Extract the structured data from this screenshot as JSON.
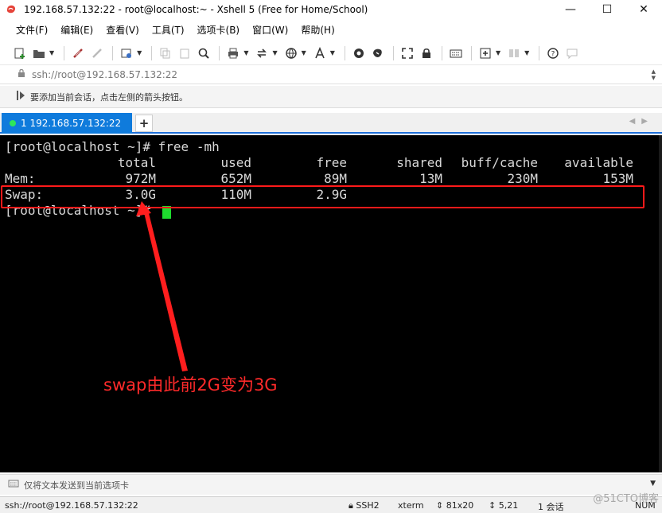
{
  "window": {
    "title": "192.168.57.132:22 - root@localhost:~ - Xshell 5 (Free for Home/School)",
    "minimize": "—",
    "maximize": "☐",
    "close": "✕"
  },
  "menu": [
    "文件(F)",
    "编辑(E)",
    "查看(V)",
    "工具(T)",
    "选项卡(B)",
    "窗口(W)",
    "帮助(H)"
  ],
  "address": {
    "value": "ssh://root@192.168.57.132:22"
  },
  "hint": {
    "text": "要添加当前会话，点击左侧的箭头按钮。"
  },
  "tabs": [
    {
      "label": "1 192.168.57.132:22",
      "active": true,
      "status_color": "#2ee65a"
    }
  ],
  "terminal": {
    "prompt_line": "[root@localhost ~]# free -mh",
    "headers": [
      "total",
      "used",
      "free",
      "shared",
      "buff/cache",
      "available"
    ],
    "mem": {
      "label": "Mem:",
      "total": "972M",
      "used": "652M",
      "free": "89M",
      "shared": "13M",
      "buff_cache": "230M",
      "available": "153M"
    },
    "swap": {
      "label": "Swap:",
      "total": "3.0G",
      "used": "110M",
      "free": "2.9G"
    },
    "last_prompt": "[root@localhost ~]# "
  },
  "annotation": {
    "text": "swap由此前2G变为3G",
    "color": "#ff2a2a"
  },
  "send_bar": {
    "text": "仅将文本发送到当前选项卡"
  },
  "status": {
    "connection": "ssh://root@192.168.57.132:22",
    "protocol": "SSH2",
    "terminal_type": "xterm",
    "size": "81x20",
    "cursor_pos": "5,21",
    "sessions": "1 会话",
    "num": "NUM"
  },
  "watermark": "@51CTO博客"
}
